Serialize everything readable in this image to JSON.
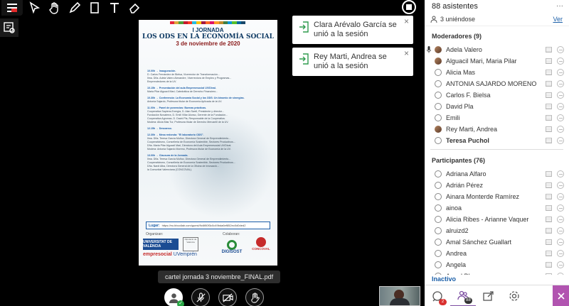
{
  "panel": {
    "attendees_title": "88 asistentes",
    "more_glyph": "···",
    "joining_count": "3 uniéndose",
    "joining_link": "Ver",
    "moderators_title": "Moderadores (9)",
    "moderators": [
      {
        "name": "Adela Valero",
        "avatar": "photo",
        "talking": true
      },
      {
        "name": "Alguacil Mari, Maria Pilar",
        "avatar": "photo"
      },
      {
        "name": "Alicia Mas",
        "avatar": "circle"
      },
      {
        "name": "ANTONIA SAJARDO MORENO",
        "avatar": "circle"
      },
      {
        "name": "Carlos F. Bielsa",
        "avatar": "circle"
      },
      {
        "name": "David Pla",
        "avatar": "circle"
      },
      {
        "name": "Emili",
        "avatar": "circle"
      },
      {
        "name": "Rey Marti, Andrea",
        "avatar": "photo"
      },
      {
        "name": "Teresa Puchol",
        "avatar": "circle",
        "bold": true
      }
    ],
    "participants_title": "Participantes (76)",
    "participants": [
      {
        "name": "Adriana Alfaro"
      },
      {
        "name": "Adrián Pérez"
      },
      {
        "name": "Ainara Monterde Ramírez"
      },
      {
        "name": "ainoa"
      },
      {
        "name": "Alicia Ribes - Arianne Vaquer"
      },
      {
        "name": "alruizd2"
      },
      {
        "name": "Amal Sánchez Guallart"
      },
      {
        "name": "Andrea"
      },
      {
        "name": "Angela"
      },
      {
        "name": "Angel Bl..."
      }
    ],
    "inactive_label": "Inactivo",
    "nav": {
      "chat_badge": "2",
      "attendees_badge": "88"
    }
  },
  "toasts": [
    {
      "text": "Clara Arévalo García se unió a la sesión",
      "close": "×"
    },
    {
      "text": "Rey Marti, Andrea se unió a la sesión",
      "close": "×"
    }
  ],
  "file_name": "cartel jornada 3 noviembre_FINAL.pdf",
  "poster": {
    "line1": "I JORNADA",
    "line2": "LOS ODS EN LA ECONOMÍA SOCIAL",
    "line3": "3 de noviembre de 2020",
    "sdg_colors": [
      "#e5243b",
      "#dda63a",
      "#4c9f38",
      "#c5192d",
      "#ff3a21",
      "#26bde2",
      "#fcc30b",
      "#a21942",
      "#fd6925",
      "#dd1367",
      "#fd9d24",
      "#bf8b2e",
      "#3f7e44",
      "#0a97d9",
      "#56c02b",
      "#00689d",
      "#19486a"
    ],
    "program": [
      {
        "h": "10.00h → Inauguración.",
        "t": ""
      },
      {
        "h": "",
        "t": "D. Carlos Fernández de Bielsa, Vicerrector de Transformación..."
      },
      {
        "h": "",
        "t": "Ilma. Dña. Adela Valero Alexandre, Vicerrectora de Empleo y Programas..."
      },
      {
        "h": "",
        "t": "Emprendedores de la UV."
      },
      {
        "h": "10.15h → Presentación del aula Emprenesocial UV/Dival.",
        "t": ""
      },
      {
        "h": "",
        "t": "Maria Pilar Alguacil Mari, Catedrática de Derecho Financiero..."
      },
      {
        "h": "10.30h → Conferencia: La Economía Social y los ODS: Un binomio de sinergias.",
        "t": ""
      },
      {
        "h": "",
        "t": "Antonia Sajardo, Profesora titular de Economía Aplicada de la UV."
      },
      {
        "h": "11.00h → Panel de ponencias: Buenas prácticas.",
        "t": ""
      },
      {
        "h": "",
        "t": "Cooperativa Sapiens-Energia, D. Alan Swell, Presidente y director..."
      },
      {
        "h": "",
        "t": "Fundación Novaterra, D. Emili Villar Alonso, Gerente de la Fundación..."
      },
      {
        "h": "",
        "t": "Cooperativa Agromax, D. David Pla, Responsable de la Cooperativa."
      },
      {
        "h": "",
        "t": "Modera: Alicia Mas Tur, Profesora titular de Derecho Mercantil de la UV."
      },
      {
        "h": "12.15h → Descanso.",
        "t": ""
      },
      {
        "h": "12.30h → Mesa redonda: \"El laboratorio ODS\".",
        "t": ""
      },
      {
        "h": "",
        "t": "Ilma. Dña. Teresa García Muñoz, Directora General de Emprendimiento..."
      },
      {
        "h": "",
        "t": "Cooperativismo, Conselleria de Economía Sostenible, Sectores Productivos..."
      },
      {
        "h": "",
        "t": "Dña. Maria Pilar Alguacil Mari, Directora del Aula Emprenesocial UV/Dival."
      },
      {
        "h": "",
        "t": "Modera: Antonia Sajardo Moreno, Profesora titular de Economía de la UV."
      },
      {
        "h": "13.00h → Clausura de la Jornada.",
        "t": ""
      },
      {
        "h": "",
        "t": "Ilma. Dña. Teresa García Muñoz, Directora General de Emprendimiento..."
      },
      {
        "h": "",
        "t": "Cooperativismo, Conselleria de Economía Sostenible, Sectores Productivos..."
      },
      {
        "h": "",
        "t": "Dña. Nardi Alba, Directora General de la Oficina de Innovació..."
      },
      {
        "h": "",
        "t": "la Comunitat Valenciana (CONCOVAL)."
      }
    ],
    "place_label": "Lugar:",
    "place_url": "https://eu.bbcollab.com/guest/9c6f80f3c0c49bda6ef852ec0d0ded2",
    "organizers_label": "Organizan:",
    "collaborators_label": "Colaboran:",
    "logo_valencia": "UNIVERSITAT DE VALÈNCIA",
    "logo_gva": "Diputació de València",
    "logo_emp_a": "empresocial",
    "logo_emp_b": " UVemprén",
    "logo_digi": "DIGISOST",
    "logo_conc": "CONCOVAL"
  },
  "icons": {
    "toolbar": [
      "menu-icon",
      "select-arrow-icon",
      "hand-icon",
      "pencil-icon",
      "rectangle-icon",
      "text-icon",
      "eraser-icon"
    ],
    "side": "whiteboard-icon",
    "media": [
      "avatar-icon",
      "mic-off-icon",
      "camera-off-icon",
      "raise-hand-icon"
    ],
    "nav": [
      "chat-icon",
      "attendees-icon",
      "share-content-icon",
      "settings-icon"
    ]
  }
}
